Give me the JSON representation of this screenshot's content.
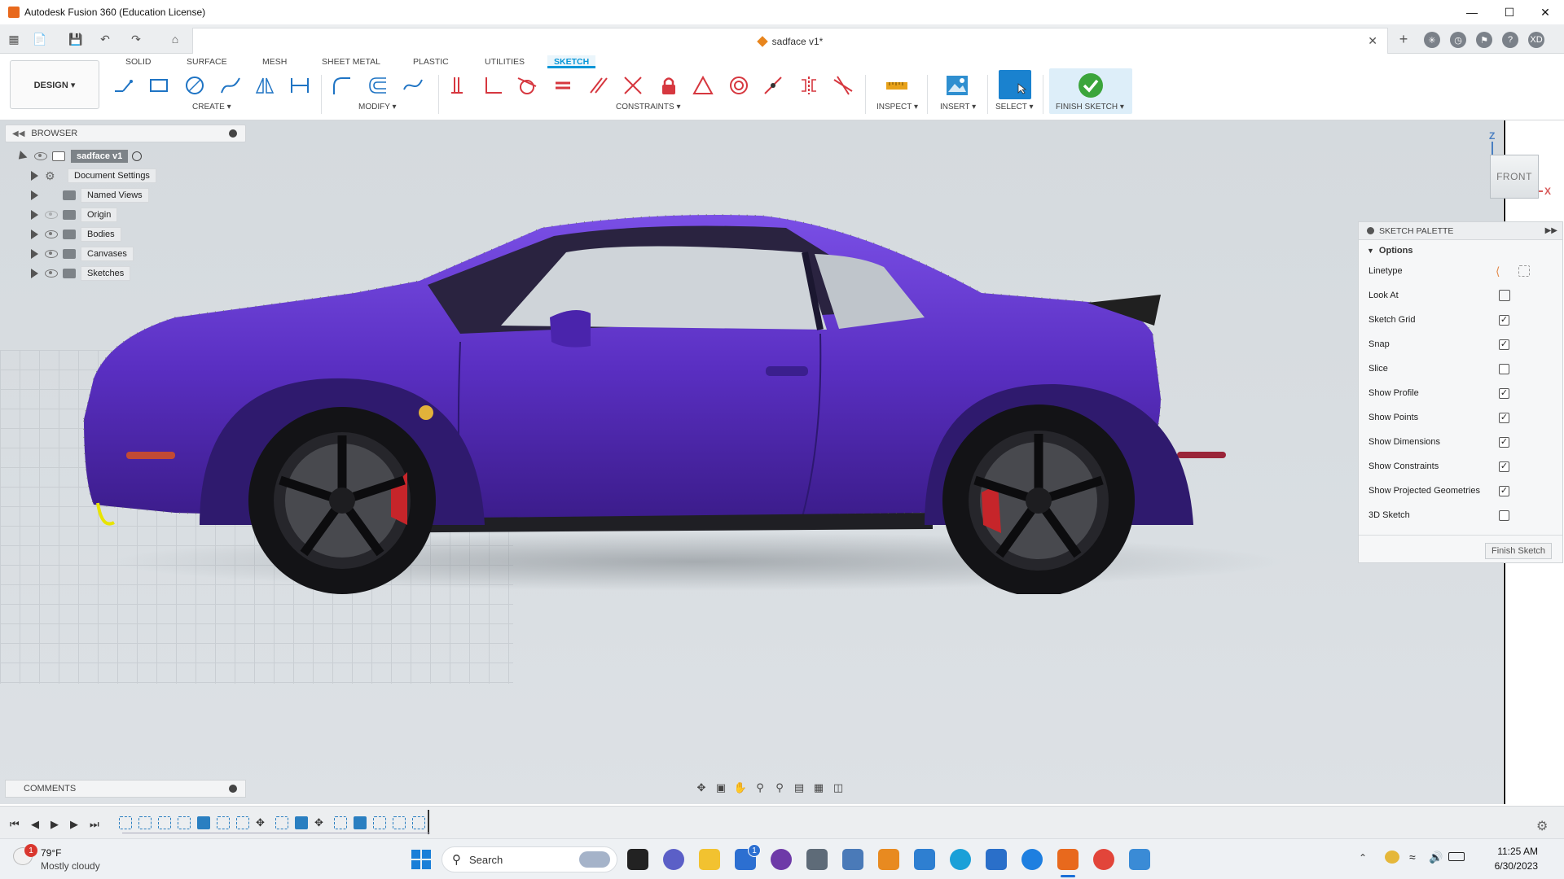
{
  "window": {
    "title": "Autodesk Fusion 360 (Education License)"
  },
  "document": {
    "tab_title": "sadface v1*",
    "user_initials": "XD"
  },
  "ribbon": {
    "workspace": "DESIGN ▾",
    "tabs": [
      "SOLID",
      "SURFACE",
      "MESH",
      "SHEET METAL",
      "PLASTIC",
      "UTILITIES",
      "SKETCH"
    ],
    "active_tab": "SKETCH",
    "groups": {
      "create": "CREATE ▾",
      "modify": "MODIFY ▾",
      "constraints": "CONSTRAINTS ▾",
      "inspect": "INSPECT ▾",
      "insert": "INSERT ▾",
      "select": "SELECT ▾",
      "finish": "FINISH SKETCH ▾"
    },
    "accent": "#0696d7"
  },
  "browser": {
    "title": "BROWSER",
    "root": "sadface v1",
    "items": [
      {
        "label": "Document Settings",
        "icon": "gear-icon"
      },
      {
        "label": "Named Views",
        "icon": "folder-icon"
      },
      {
        "label": "Origin",
        "icon": "folder-icon"
      },
      {
        "label": "Bodies",
        "icon": "folder-icon"
      },
      {
        "label": "Canvases",
        "icon": "folder-icon"
      },
      {
        "label": "Sketches",
        "icon": "folder-icon"
      }
    ]
  },
  "viewcube": {
    "face": "FRONT",
    "z_axis": "Z",
    "x_axis": "X"
  },
  "sketch_palette": {
    "title": "SKETCH PALETTE",
    "section": "Options",
    "options": [
      {
        "label": "Linetype",
        "control": "linetype"
      },
      {
        "label": "Look At",
        "control": "button"
      },
      {
        "label": "Sketch Grid",
        "control": "checkbox",
        "checked": true
      },
      {
        "label": "Snap",
        "control": "checkbox",
        "checked": true
      },
      {
        "label": "Slice",
        "control": "checkbox",
        "checked": false
      },
      {
        "label": "Show Profile",
        "control": "checkbox",
        "checked": true
      },
      {
        "label": "Show Points",
        "control": "checkbox",
        "checked": true
      },
      {
        "label": "Show Dimensions",
        "control": "checkbox",
        "checked": true
      },
      {
        "label": "Show Constraints",
        "control": "checkbox",
        "checked": true
      },
      {
        "label": "Show Projected Geometries",
        "control": "checkbox",
        "checked": true
      },
      {
        "label": "3D Sketch",
        "control": "checkbox",
        "checked": false
      }
    ],
    "finish_button": "Finish Sketch"
  },
  "comments": {
    "title": "COMMENTS"
  },
  "canvas": {
    "car_color": "#5a2fc2"
  },
  "taskbar": {
    "weather_temp": "79°F",
    "weather_desc": "Mostly cloudy",
    "weather_badge": "1",
    "search_label": "Search",
    "store_badge": "1",
    "time": "11:25 AM",
    "date": "6/30/2023"
  }
}
